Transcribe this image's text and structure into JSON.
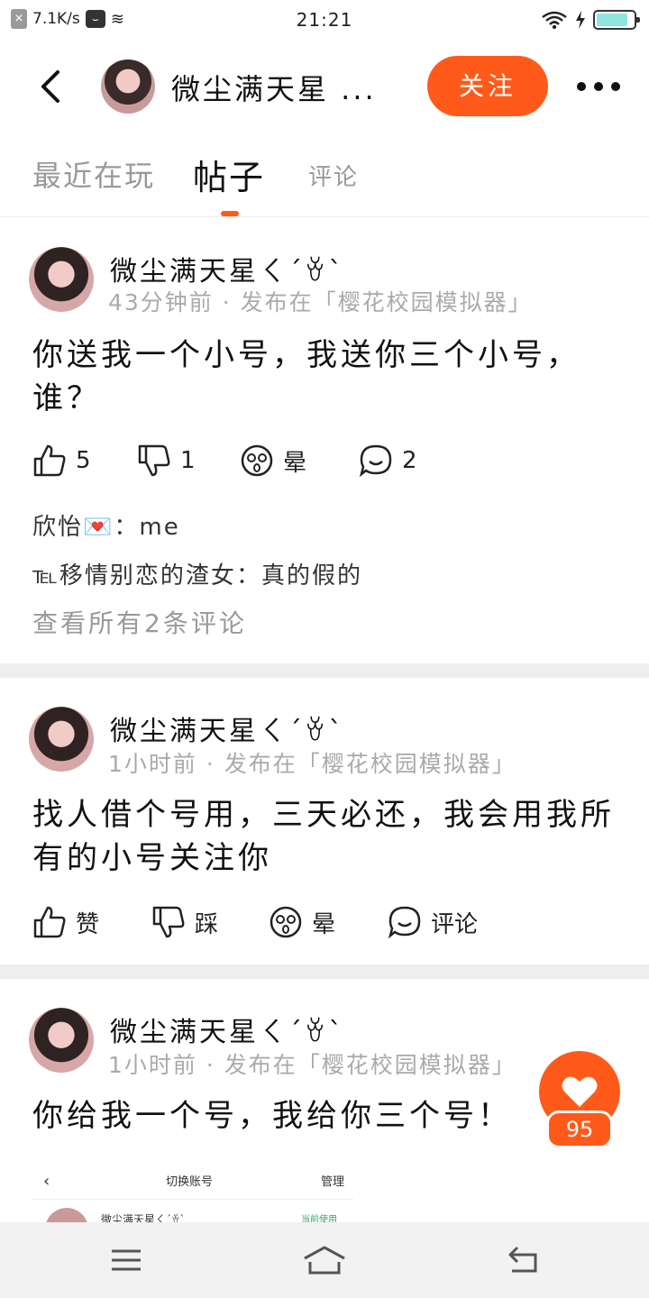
{
  "status_bar": {
    "net_speed": "7.1K/s",
    "time": "21:21",
    "battery_level": 0.85
  },
  "header": {
    "back_icon": "chevron-left-icon",
    "username": "微尘满天星 ...",
    "follow_label": "关注",
    "more_icon": "more-horizontal-icon"
  },
  "tabs": [
    {
      "label": "最近在玩",
      "active": false
    },
    {
      "label": "帖子",
      "active": true
    },
    {
      "label": "评论",
      "active": false
    }
  ],
  "posts": [
    {
      "author": "微尘满天星ㄑ´ꈊ`",
      "meta": "43分钟前 · 发布在「樱花校园模拟器」",
      "text": "你送我一个小号，我送你三个小号，谁？",
      "actions": {
        "like": "5",
        "dislike": "1",
        "dizzy": "晕",
        "comment": "2"
      },
      "comments": [
        {
          "user": "欣怡💌",
          "text": "：me"
        },
        {
          "user": "℡移情别恋的渣女",
          "text": "：真的假的"
        }
      ],
      "see_all": "查看所有2条评论"
    },
    {
      "author": "微尘满天星ㄑ´ꈊ`",
      "meta": "1小时前 · 发布在「樱花校园模拟器」",
      "text": "找人借个号用，三天必还，我会用我所有的小号关注你",
      "actions": {
        "like": "赞",
        "dislike": "踩",
        "dizzy": "晕",
        "comment": "评论"
      }
    },
    {
      "author": "微尘满天星ㄑ´ꈊ`",
      "meta": "1小时前 · 发布在「樱花校园模拟器」",
      "text": "你给我一个号，我给你三个号！",
      "image": {
        "title": "切换账号",
        "manage": "管理",
        "account_name": "微尘满天星ㄑ´ꈊ`",
        "current_label": "当前使用"
      }
    }
  ],
  "like_fab": {
    "count": "95"
  },
  "colors": {
    "accent": "#ff5a1a",
    "muted_text": "#999999",
    "separator": "#eeeeee"
  }
}
